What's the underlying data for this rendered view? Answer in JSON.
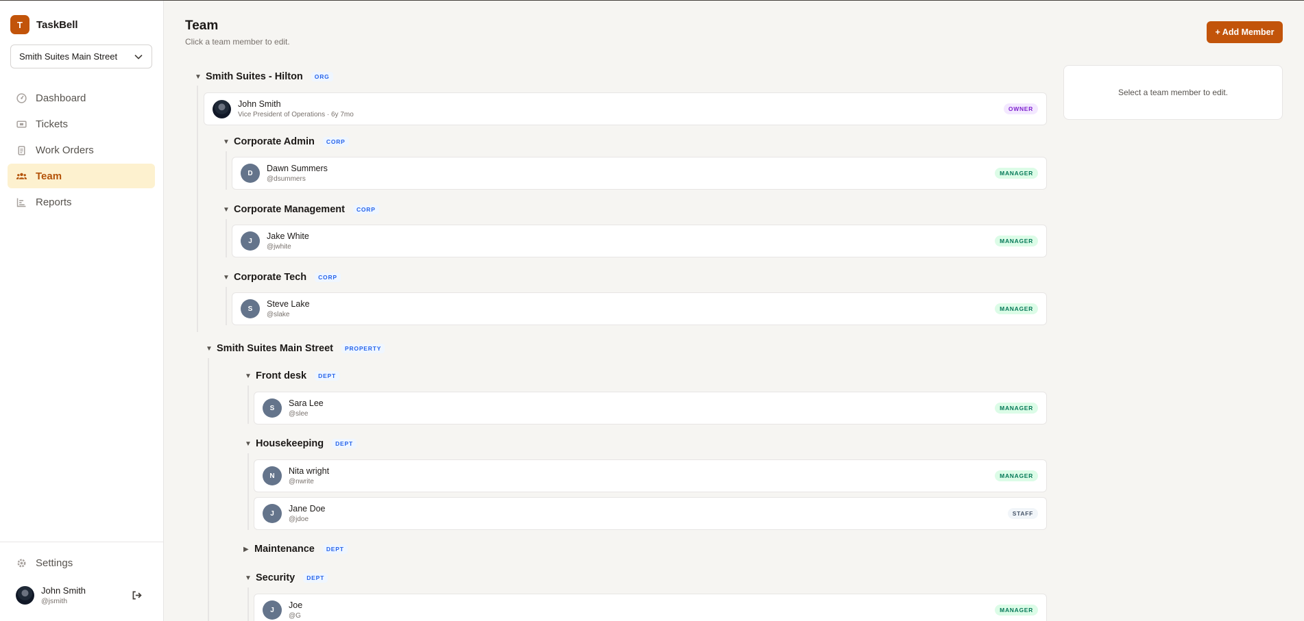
{
  "app": {
    "logo_letter": "T",
    "name": "TaskBell"
  },
  "property_select": {
    "value": "Smith Suites Main Street"
  },
  "nav": [
    {
      "label": "Dashboard",
      "icon": "dashboard-icon"
    },
    {
      "label": "Tickets",
      "icon": "ticket-icon"
    },
    {
      "label": "Work Orders",
      "icon": "clipboard-icon"
    },
    {
      "label": "Team",
      "icon": "users-icon",
      "active": true
    },
    {
      "label": "Reports",
      "icon": "chart-icon"
    }
  ],
  "settings_label": "Settings",
  "current_user": {
    "name": "John Smith",
    "handle": "@jsmith"
  },
  "page": {
    "title": "Team",
    "subtitle": "Click a team member to edit.",
    "add_button": "+ Add Member",
    "detail_placeholder": "Select a team member to edit."
  },
  "org": {
    "name": "Smith Suites - Hilton",
    "tag": "ORG",
    "owner": {
      "name": "John Smith",
      "title": "Vice President of Operations",
      "tenure": "· 6y 7mo",
      "badge": "OWNER"
    },
    "corp_groups": [
      {
        "name": "Corporate Admin",
        "tag": "CORP",
        "members": [
          {
            "initial": "D",
            "name": "Dawn Summers",
            "handle": "@dsummers",
            "badge": "MANAGER"
          }
        ]
      },
      {
        "name": "Corporate Management",
        "tag": "CORP",
        "members": [
          {
            "initial": "J",
            "name": "Jake White",
            "handle": "@jwhite",
            "badge": "MANAGER"
          }
        ]
      },
      {
        "name": "Corporate Tech",
        "tag": "CORP",
        "members": [
          {
            "initial": "S",
            "name": "Steve Lake",
            "handle": "@slake",
            "badge": "MANAGER"
          }
        ]
      }
    ],
    "property": {
      "name": "Smith Suites Main Street",
      "tag": "PROPERTY",
      "depts": [
        {
          "name": "Front desk",
          "tag": "DEPT",
          "members": [
            {
              "initial": "S",
              "name": "Sara Lee",
              "handle": "@slee",
              "badge": "MANAGER"
            }
          ]
        },
        {
          "name": "Housekeeping",
          "tag": "DEPT",
          "members": [
            {
              "initial": "N",
              "name": "Nita wright",
              "handle": "@nwrite",
              "badge": "MANAGER"
            },
            {
              "initial": "J",
              "name": "Jane Doe",
              "handle": "@jdoe",
              "badge": "STAFF"
            }
          ]
        },
        {
          "name": "Maintenance",
          "tag": "DEPT",
          "collapsed": true,
          "members": []
        },
        {
          "name": "Security",
          "tag": "DEPT",
          "members": [
            {
              "initial": "J",
              "name": "Joe",
              "handle": "@G",
              "badge": "MANAGER"
            }
          ]
        }
      ]
    }
  },
  "colors": {
    "accent": "#c2540a",
    "active_nav_bg": "#fdf1cf",
    "tag_blue": "#2563eb",
    "manager_green": "#047857"
  }
}
